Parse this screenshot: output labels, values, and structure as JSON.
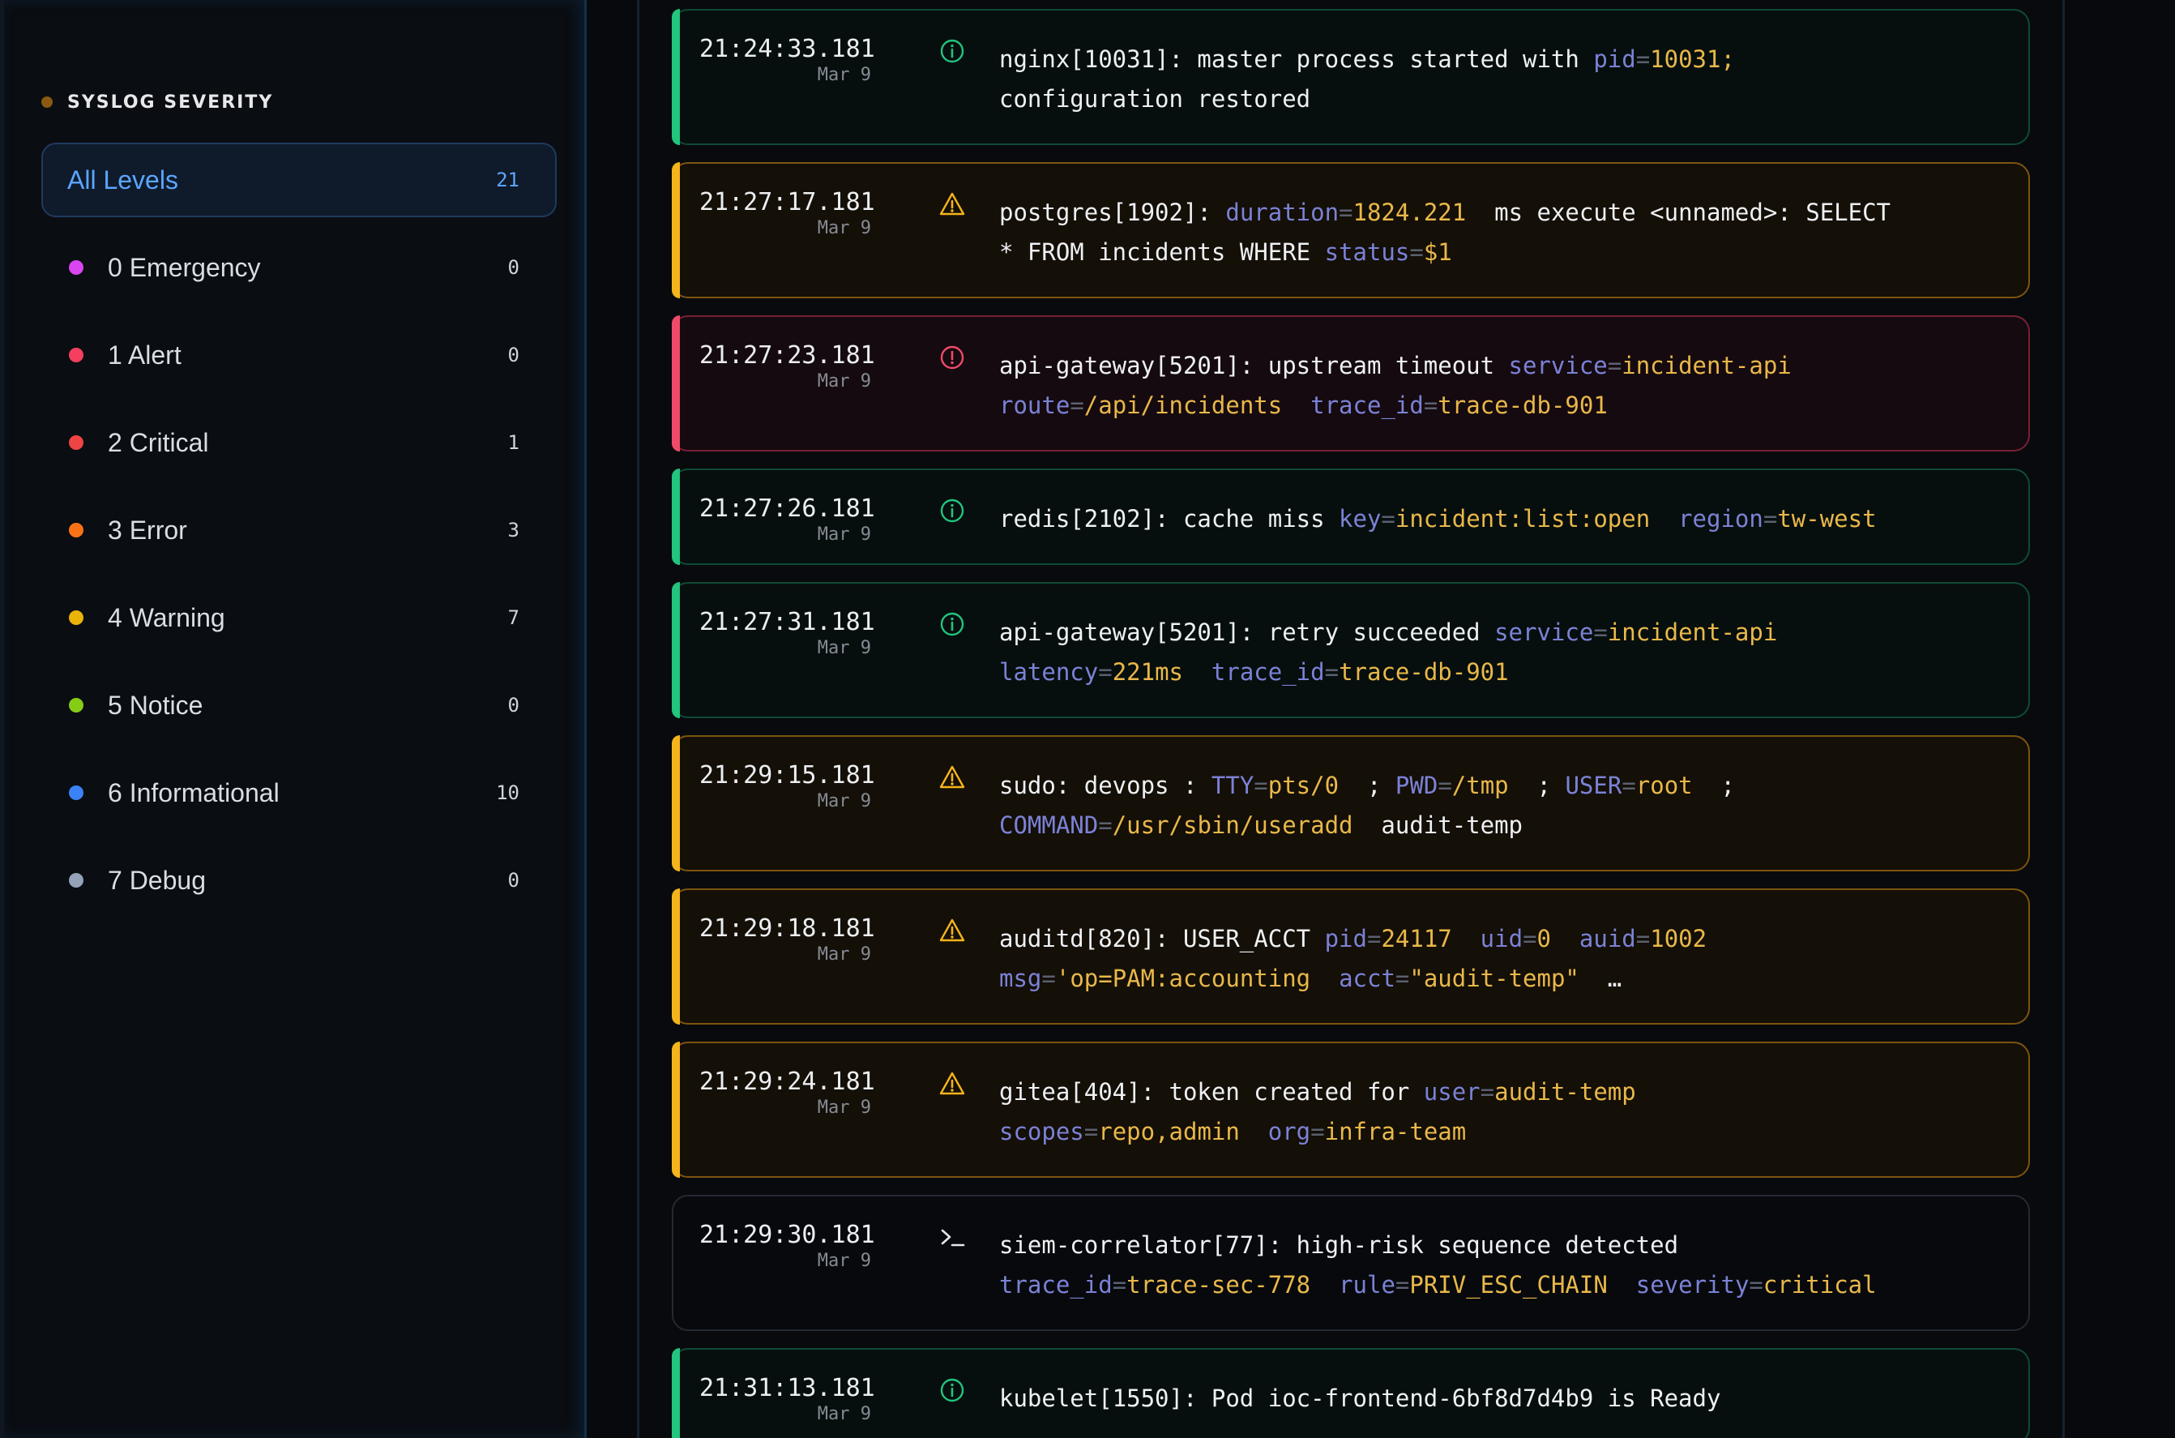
{
  "sidebar": {
    "section_title": "SYSLOG SEVERITY",
    "levels": [
      {
        "label": "All Levels",
        "count": "21",
        "color": "",
        "active": true
      },
      {
        "label": "0 Emergency",
        "count": "0",
        "color": "#d946ef"
      },
      {
        "label": "1 Alert",
        "count": "0",
        "color": "#f43f5e"
      },
      {
        "label": "2 Critical",
        "count": "1",
        "color": "#ef4444"
      },
      {
        "label": "3 Error",
        "count": "3",
        "color": "#f97316"
      },
      {
        "label": "4 Warning",
        "count": "7",
        "color": "#eab308"
      },
      {
        "label": "5 Notice",
        "count": "0",
        "color": "#84cc16"
      },
      {
        "label": "6 Informational",
        "count": "10",
        "color": "#3b82f6"
      },
      {
        "label": "7 Debug",
        "count": "0",
        "color": "#94a3b8"
      }
    ]
  },
  "logs": [
    {
      "time": "21:24:33.181",
      "date": "Mar 9",
      "level": "info",
      "icon": "info-icon",
      "lines": [
        [
          {
            "t": "nginx[10031]: master process started with "
          },
          {
            "k": "pid",
            "v": "10031;"
          }
        ],
        [
          {
            "t": "configuration restored"
          }
        ]
      ]
    },
    {
      "time": "21:27:17.181",
      "date": "Mar 9",
      "level": "warn",
      "icon": "warning-icon",
      "lines": [
        [
          {
            "t": "postgres[1902]: "
          },
          {
            "k": "duration",
            "v": "1824.221"
          },
          {
            "t": "  ms execute <unnamed>: SELECT"
          }
        ],
        [
          {
            "t": "* FROM incidents WHERE "
          },
          {
            "k": "status",
            "v": "$1"
          }
        ]
      ]
    },
    {
      "time": "21:27:23.181",
      "date": "Mar 9",
      "level": "err",
      "icon": "error-icon",
      "lines": [
        [
          {
            "t": "api-gateway[5201]: upstream timeout "
          },
          {
            "k": "service",
            "v": "incident-api"
          }
        ],
        [
          {
            "k": "route",
            "v": "/api/incidents"
          },
          {
            "t": "  "
          },
          {
            "k": "trace_id",
            "v": "trace-db-901"
          }
        ]
      ]
    },
    {
      "time": "21:27:26.181",
      "date": "Mar 9",
      "level": "info",
      "icon": "info-icon",
      "lines": [
        [
          {
            "t": "redis[2102]: cache miss "
          },
          {
            "k": "key",
            "v": "incident:list:open"
          },
          {
            "t": "  "
          },
          {
            "k": "region",
            "v": "tw-west"
          }
        ]
      ]
    },
    {
      "time": "21:27:31.181",
      "date": "Mar 9",
      "level": "info",
      "icon": "info-icon",
      "lines": [
        [
          {
            "t": "api-gateway[5201]: retry succeeded "
          },
          {
            "k": "service",
            "v": "incident-api"
          }
        ],
        [
          {
            "k": "latency",
            "v": "221ms"
          },
          {
            "t": "  "
          },
          {
            "k": "trace_id",
            "v": "trace-db-901"
          }
        ]
      ]
    },
    {
      "time": "21:29:15.181",
      "date": "Mar 9",
      "level": "warn",
      "icon": "warning-icon",
      "lines": [
        [
          {
            "t": "sudo: devops : "
          },
          {
            "k": "TTY",
            "v": "pts/0"
          },
          {
            "t": "  ; "
          },
          {
            "k": "PWD",
            "v": "/tmp"
          },
          {
            "t": "  ; "
          },
          {
            "k": "USER",
            "v": "root"
          },
          {
            "t": "  ;"
          }
        ],
        [
          {
            "k": "COMMAND",
            "v": "/usr/sbin/useradd"
          },
          {
            "t": "  audit-temp"
          }
        ]
      ]
    },
    {
      "time": "21:29:18.181",
      "date": "Mar 9",
      "level": "warn",
      "icon": "warning-icon",
      "lines": [
        [
          {
            "t": "auditd[820]: USER_ACCT "
          },
          {
            "k": "pid",
            "v": "24117"
          },
          {
            "t": "  "
          },
          {
            "k": "uid",
            "v": "0"
          },
          {
            "t": "  "
          },
          {
            "k": "auid",
            "v": "1002"
          }
        ],
        [
          {
            "k": "msg",
            "v": "'op=PAM:accounting"
          },
          {
            "t": "  "
          },
          {
            "k": "acct",
            "v": "\"audit-temp\""
          },
          {
            "t": "  …"
          }
        ]
      ]
    },
    {
      "time": "21:29:24.181",
      "date": "Mar 9",
      "level": "warn",
      "icon": "warning-icon",
      "lines": [
        [
          {
            "t": "gitea[404]: token created for "
          },
          {
            "k": "user",
            "v": "audit-temp"
          }
        ],
        [
          {
            "k": "scopes",
            "v": "repo,admin"
          },
          {
            "t": "  "
          },
          {
            "k": "org",
            "v": "infra-team"
          }
        ]
      ]
    },
    {
      "time": "21:29:30.181",
      "date": "Mar 9",
      "level": "sec",
      "icon": "terminal-icon",
      "lines": [
        [
          {
            "t": "siem-correlator[77]: high-risk sequence detected"
          }
        ],
        [
          {
            "k": "trace_id",
            "v": "trace-sec-778"
          },
          {
            "t": "  "
          },
          {
            "k": "rule",
            "v": "PRIV_ESC_CHAIN"
          },
          {
            "t": "  "
          },
          {
            "k": "severity",
            "v": "critical"
          }
        ]
      ]
    },
    {
      "time": "21:31:13.181",
      "date": "Mar 9",
      "level": "info",
      "icon": "info-icon",
      "lines": [
        [
          {
            "t": "kubelet[1550]: Pod ioc-frontend-6bf8d7d4b9 is Ready"
          }
        ]
      ]
    }
  ],
  "colors": {
    "info": "#22c47e",
    "warn": "#f5b41b",
    "err": "#f04a6a",
    "sec": "#e5e7eb",
    "key": "#7b82d6",
    "value": "#e9b84a"
  }
}
